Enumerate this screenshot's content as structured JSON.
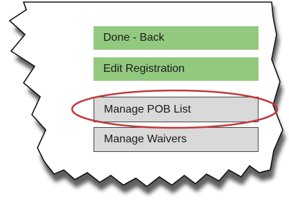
{
  "buttons": {
    "done_back": "Done - Back",
    "edit_registration": "Edit Registration",
    "manage_pob_list": "Manage POB List",
    "manage_waivers": "Manage Waivers"
  },
  "colors": {
    "green_button": "#92c97f",
    "gray_button": "#d9d9d9",
    "highlight_ring": "#c0393b",
    "torn_edge": "#111111"
  }
}
